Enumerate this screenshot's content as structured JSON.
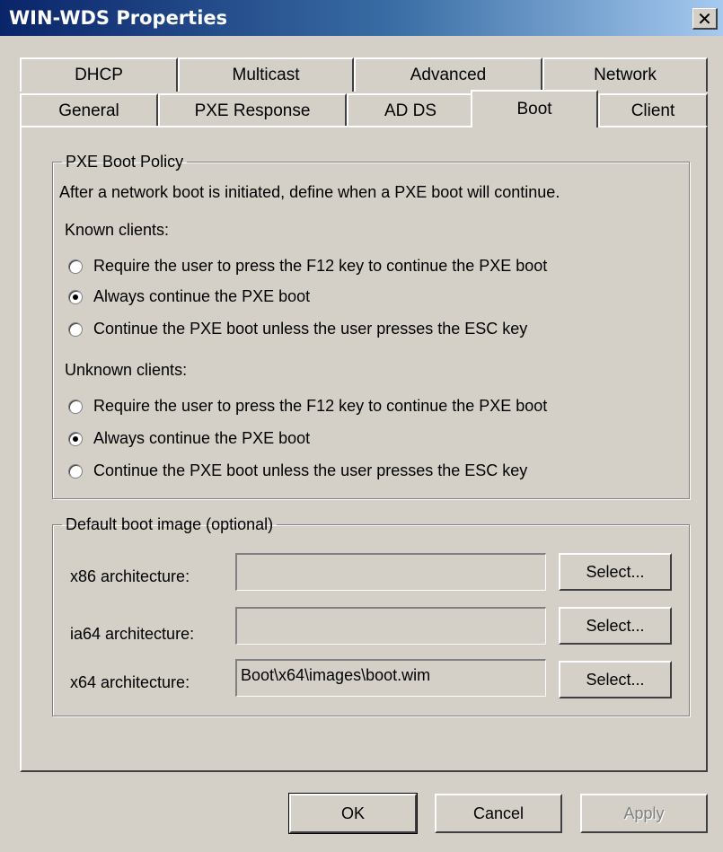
{
  "window": {
    "title": "WIN-WDS Properties",
    "close_glyph": "✕"
  },
  "tabs": {
    "row1": [
      {
        "label": "DHCP"
      },
      {
        "label": "Multicast"
      },
      {
        "label": "Advanced"
      },
      {
        "label": "Network"
      }
    ],
    "row2": [
      {
        "label": "General"
      },
      {
        "label": "PXE Response"
      },
      {
        "label": "AD DS"
      },
      {
        "label": "Boot",
        "selected": true
      },
      {
        "label": "Client"
      }
    ]
  },
  "pxe_policy": {
    "title": "PXE Boot Policy",
    "description": "After a network boot is initiated, define when a PXE boot will continue.",
    "known_label": "Known clients:",
    "known_options": [
      {
        "label": "Require the user to press the F12 key to continue the PXE boot",
        "checked": false
      },
      {
        "label": "Always continue the PXE boot",
        "checked": true
      },
      {
        "label": "Continue the PXE boot unless the user presses the ESC key",
        "checked": false
      }
    ],
    "unknown_label": "Unknown clients:",
    "unknown_options": [
      {
        "label": "Require the user to press the F12 key to continue the PXE boot",
        "checked": false
      },
      {
        "label": "Always continue the PXE boot",
        "checked": true
      },
      {
        "label": "Continue the PXE boot unless the user presses the ESC key",
        "checked": false
      }
    ]
  },
  "boot_image": {
    "title": "Default boot image (optional)",
    "rows": [
      {
        "label": "x86 architecture:",
        "value": "",
        "button": "Select..."
      },
      {
        "label": "ia64 architecture:",
        "value": "",
        "button": "Select..."
      },
      {
        "label": "x64 architecture:",
        "value": "Boot\\x64\\images\\boot.wim",
        "button": "Select..."
      }
    ]
  },
  "footer": {
    "ok": "OK",
    "cancel": "Cancel",
    "apply": "Apply"
  }
}
